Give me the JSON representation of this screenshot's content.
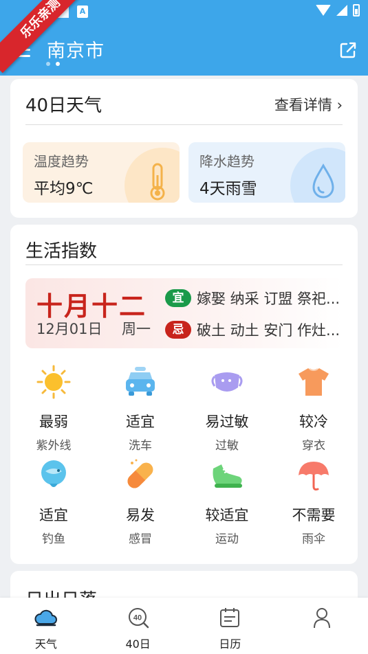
{
  "watermark": "乐乐亲测",
  "header": {
    "city": "南京市",
    "status_badge": "A",
    "colors": {
      "header_bg": "#3da6ea"
    }
  },
  "forecast40": {
    "title": "40日天气",
    "detail_link": "查看详情",
    "temp_trend": {
      "title": "温度趋势",
      "value": "平均9℃",
      "icon": "thermometer-icon"
    },
    "rain_trend": {
      "title": "降水趋势",
      "value": "4天雨雪",
      "icon": "raindrop-icon"
    }
  },
  "life": {
    "title": "生活指数",
    "almanac": {
      "lunar_date": "十月十二",
      "date": "12月01日",
      "weekday": "周一",
      "yi_badge": "宜",
      "yi_text": "嫁娶 纳采 订盟 祭祀...",
      "ji_badge": "忌",
      "ji_text": "破土 动土 安门 作灶..."
    },
    "items": [
      {
        "value": "最弱",
        "label": "紫外线",
        "icon": "sun-icon"
      },
      {
        "value": "适宜",
        "label": "洗车",
        "icon": "car-icon"
      },
      {
        "value": "易过敏",
        "label": "过敏",
        "icon": "mask-icon"
      },
      {
        "value": "较冷",
        "label": "穿衣",
        "icon": "tshirt-icon"
      },
      {
        "value": "适宜",
        "label": "钓鱼",
        "icon": "fish-icon"
      },
      {
        "value": "易发",
        "label": "感冒",
        "icon": "pill-icon"
      },
      {
        "value": "较适宜",
        "label": "运动",
        "icon": "sneaker-icon"
      },
      {
        "value": "不需要",
        "label": "雨伞",
        "icon": "umbrella-icon"
      }
    ]
  },
  "sun": {
    "title": "日出日落"
  },
  "nav": {
    "items": [
      {
        "label": "天气",
        "icon": "weather-cloud-icon"
      },
      {
        "label": "40日",
        "icon": "forty-day-icon"
      },
      {
        "label": "日历",
        "icon": "calendar-icon"
      },
      {
        "label": "",
        "icon": "user-icon"
      }
    ]
  }
}
